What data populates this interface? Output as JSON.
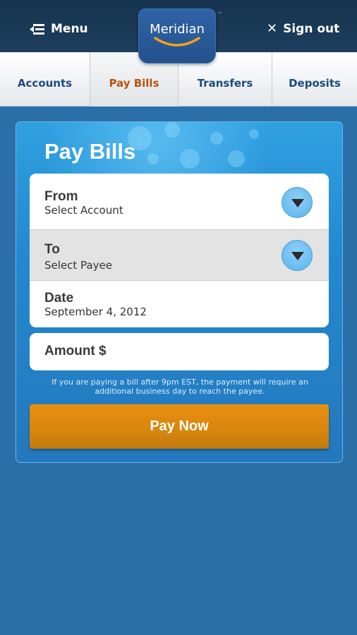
{
  "header": {
    "menu_label": "Menu",
    "signout_label": "Sign out",
    "logo_text": "Meridian",
    "trademark": "™"
  },
  "tabs": [
    {
      "label": "Accounts",
      "active": false
    },
    {
      "label": "Pay Bills",
      "active": true
    },
    {
      "label": "Transfers",
      "active": false
    },
    {
      "label": "Deposits",
      "active": false
    }
  ],
  "panel": {
    "title": "Pay Bills",
    "from": {
      "label": "From",
      "value": "Select Account"
    },
    "to": {
      "label": "To",
      "value": "Select Payee"
    },
    "date": {
      "label": "Date",
      "value": "September 4, 2012"
    },
    "amount_label": "Amount $",
    "note": "If you are paying a bill after 9pm EST, the payment will require an additional business day to reach the payee.",
    "pay_button": "Pay Now"
  },
  "colors": {
    "accent_orange": "#e08a10",
    "active_tab": "#b8520e",
    "tab_text": "#1b4b7e",
    "header_bg": "#1a3a58",
    "page_bg": "#2a6fa8"
  }
}
